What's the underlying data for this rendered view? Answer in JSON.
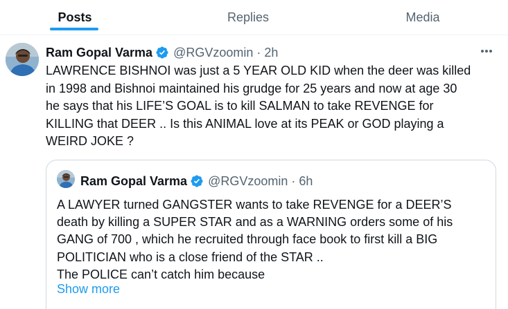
{
  "tabs": [
    {
      "label": "Posts",
      "active": true
    },
    {
      "label": "Replies",
      "active": false
    },
    {
      "label": "Media",
      "active": false
    }
  ],
  "tweet": {
    "author_name": "Ram Gopal Varma",
    "handle": "@RGVzoomin",
    "separator": "·",
    "time": "2h",
    "verified": true,
    "more_icon": "more-horizontal-icon",
    "lines": [
      "LAWRENCE BISHNOI was just a 5 YEAR OLD KID when the deer was killed",
      "in 1998 and Bishnoi maintained his grudge for 25 years and now at age 30",
      "he says that his LIFE’S GOAL is to kill SALMAN to take REVENGE for",
      "KILLING that DEER  .. Is this ANIMAL love at its PEAK or GOD playing a",
      "WEIRD JOKE ?"
    ]
  },
  "quote": {
    "author_name": "Ram Gopal Varma",
    "handle": "@RGVzoomin",
    "separator": "·",
    "time": "6h",
    "verified": true,
    "lines": [
      "A LAWYER turned GANGSTER wants to take REVENGE for a DEER’S",
      "death by killing a SUPER STAR and as a WARNING orders some of his",
      "GANG of 700 , which he recruited through face book to first kill a BIG",
      "POLITICIAN who is a close friend of the STAR ..",
      "The POLICE can’t catch him because"
    ],
    "show_more": "Show more"
  },
  "colors": {
    "accent": "#1d9bf0",
    "text": "#0f1419",
    "muted": "#536471",
    "border": "#cfd9de"
  }
}
